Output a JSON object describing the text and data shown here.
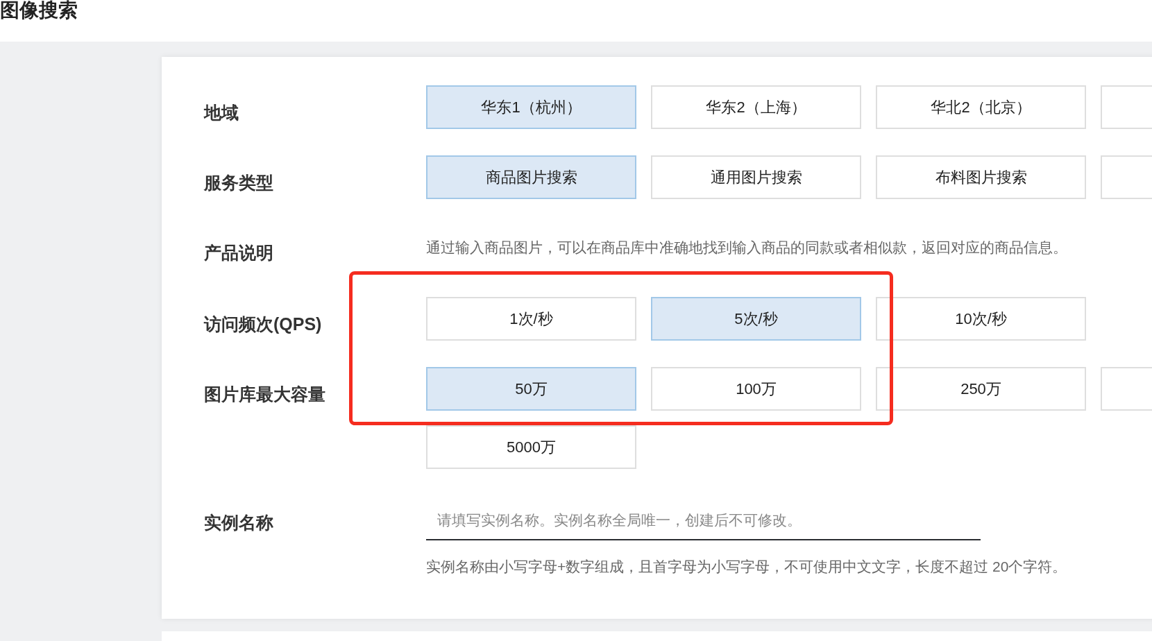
{
  "page_title": "图像搜索",
  "fields": [
    {
      "kind": "options",
      "label": "地域",
      "options": [
        {
          "label": "华东1（杭州）",
          "selected": true
        },
        {
          "label": "华东2（上海）",
          "selected": false
        },
        {
          "label": "华北2（北京）",
          "selected": false
        },
        {
          "selected": false
        }
      ]
    },
    {
      "kind": "options",
      "label": "服务类型",
      "options": [
        {
          "label": "商品图片搜索",
          "selected": true
        },
        {
          "label": "通用图片搜索",
          "selected": false
        },
        {
          "label": "布料图片搜索",
          "selected": false
        },
        {
          "selected": false
        }
      ]
    },
    {
      "kind": "text",
      "label": "产品说明",
      "text": "通过输入商品图片，可以在商品库中准确地找到输入商品的同款或者相似款，返回对应的商品信息。"
    },
    {
      "kind": "options",
      "label": "访问频次(QPS)",
      "options": [
        {
          "label": "1次/秒",
          "selected": false
        },
        {
          "label": "5次/秒",
          "selected": true
        },
        {
          "label": "10次/秒",
          "selected": false
        }
      ]
    },
    {
      "kind": "options",
      "label": "图片库最大容量",
      "options": [
        {
          "label": "50万",
          "selected": true
        },
        {
          "label": "100万",
          "selected": false
        },
        {
          "label": "250万",
          "selected": false
        },
        {
          "selected": false
        },
        {
          "label": "5000万",
          "selected": false
        }
      ]
    },
    {
      "kind": "input",
      "label": "实例名称",
      "placeholder": "请填写实例名称。实例名称全局唯一，创建后不可修改。",
      "hint": "实例名称由小写字母+数字组成，且首字母为小写字母，不可使用中文文字，长度不超过 20个字符。"
    }
  ]
}
